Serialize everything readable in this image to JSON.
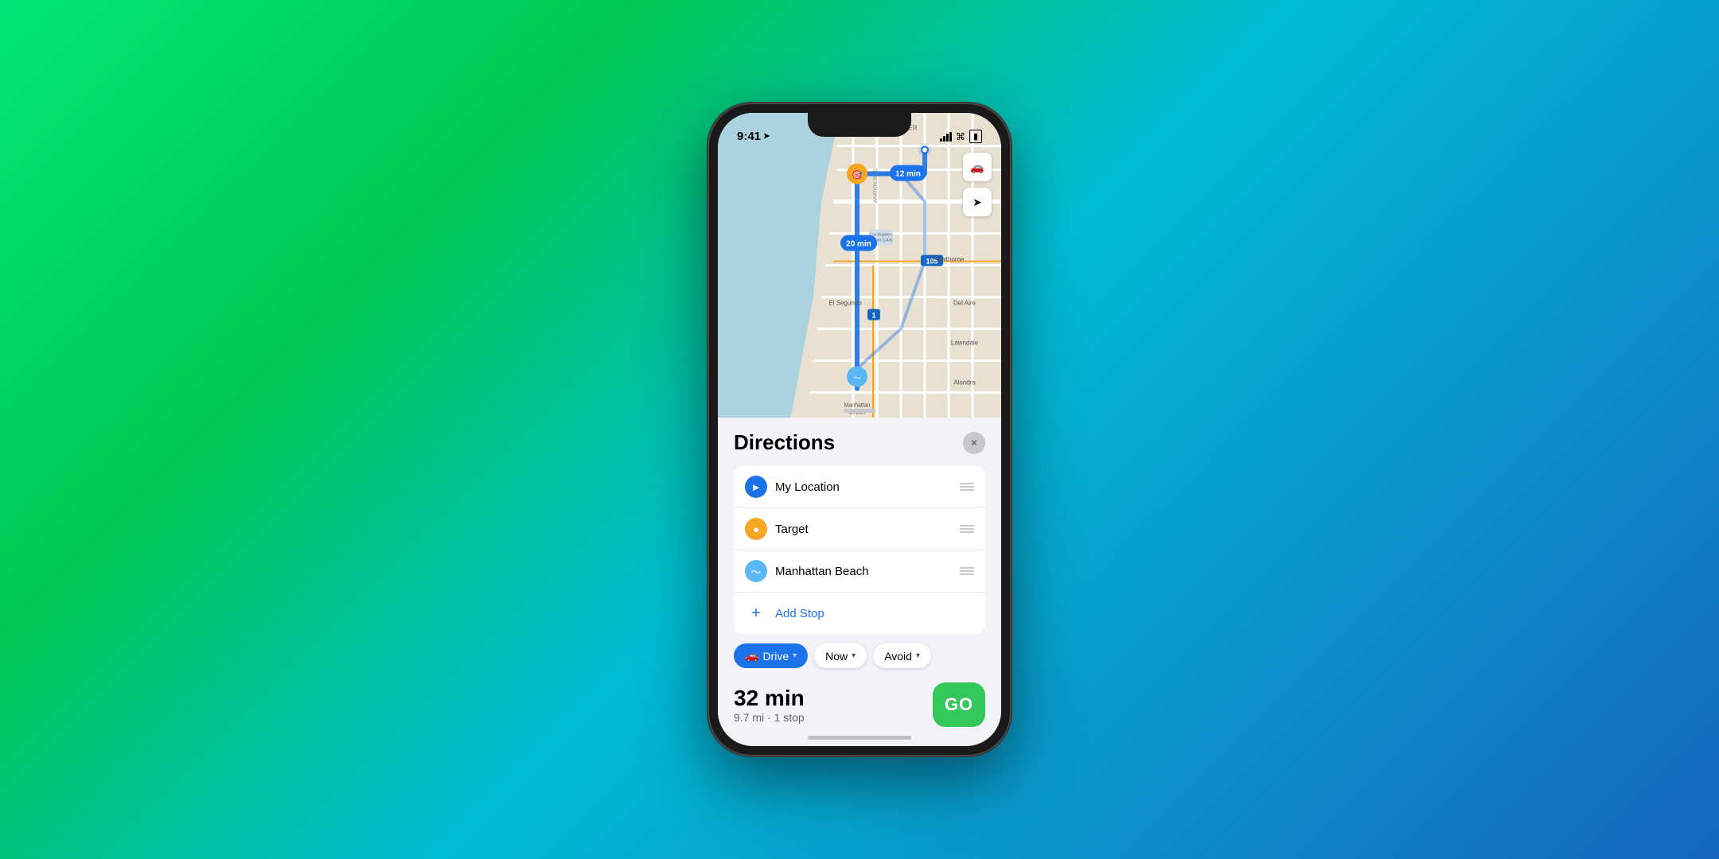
{
  "status_bar": {
    "time": "9:41",
    "time_icon": "location-arrow-icon"
  },
  "map": {
    "route_time_1": "12 min",
    "route_time_2": "20 min",
    "area_label_1": "WESTCHESTER",
    "area_label_2": "El Segundo",
    "area_label_3": "Hawthorne",
    "area_label_4": "Manhattan Beach",
    "highway_label_1": "105",
    "highway_label_2": "1"
  },
  "directions": {
    "title": "Directions",
    "close_label": "×",
    "waypoints": [
      {
        "id": "my-location",
        "name": "My Location",
        "icon_type": "blue",
        "icon_char": "▲"
      },
      {
        "id": "target",
        "name": "Target",
        "icon_type": "orange",
        "icon_char": "●"
      },
      {
        "id": "manhattan-beach",
        "name": "Manhattan Beach",
        "icon_type": "teal",
        "icon_char": "~"
      }
    ],
    "add_stop_label": "Add Stop",
    "transport_options": [
      {
        "label": "Drive",
        "icon": "car-icon",
        "active": true
      },
      {
        "label": "Now",
        "icon": "clock-icon",
        "active": false
      },
      {
        "label": "Avoid",
        "icon": "avoid-icon",
        "active": false
      }
    ],
    "summary": {
      "time": "32 min",
      "detail": "9.7 mi · 1 stop",
      "go_label": "GO"
    }
  }
}
